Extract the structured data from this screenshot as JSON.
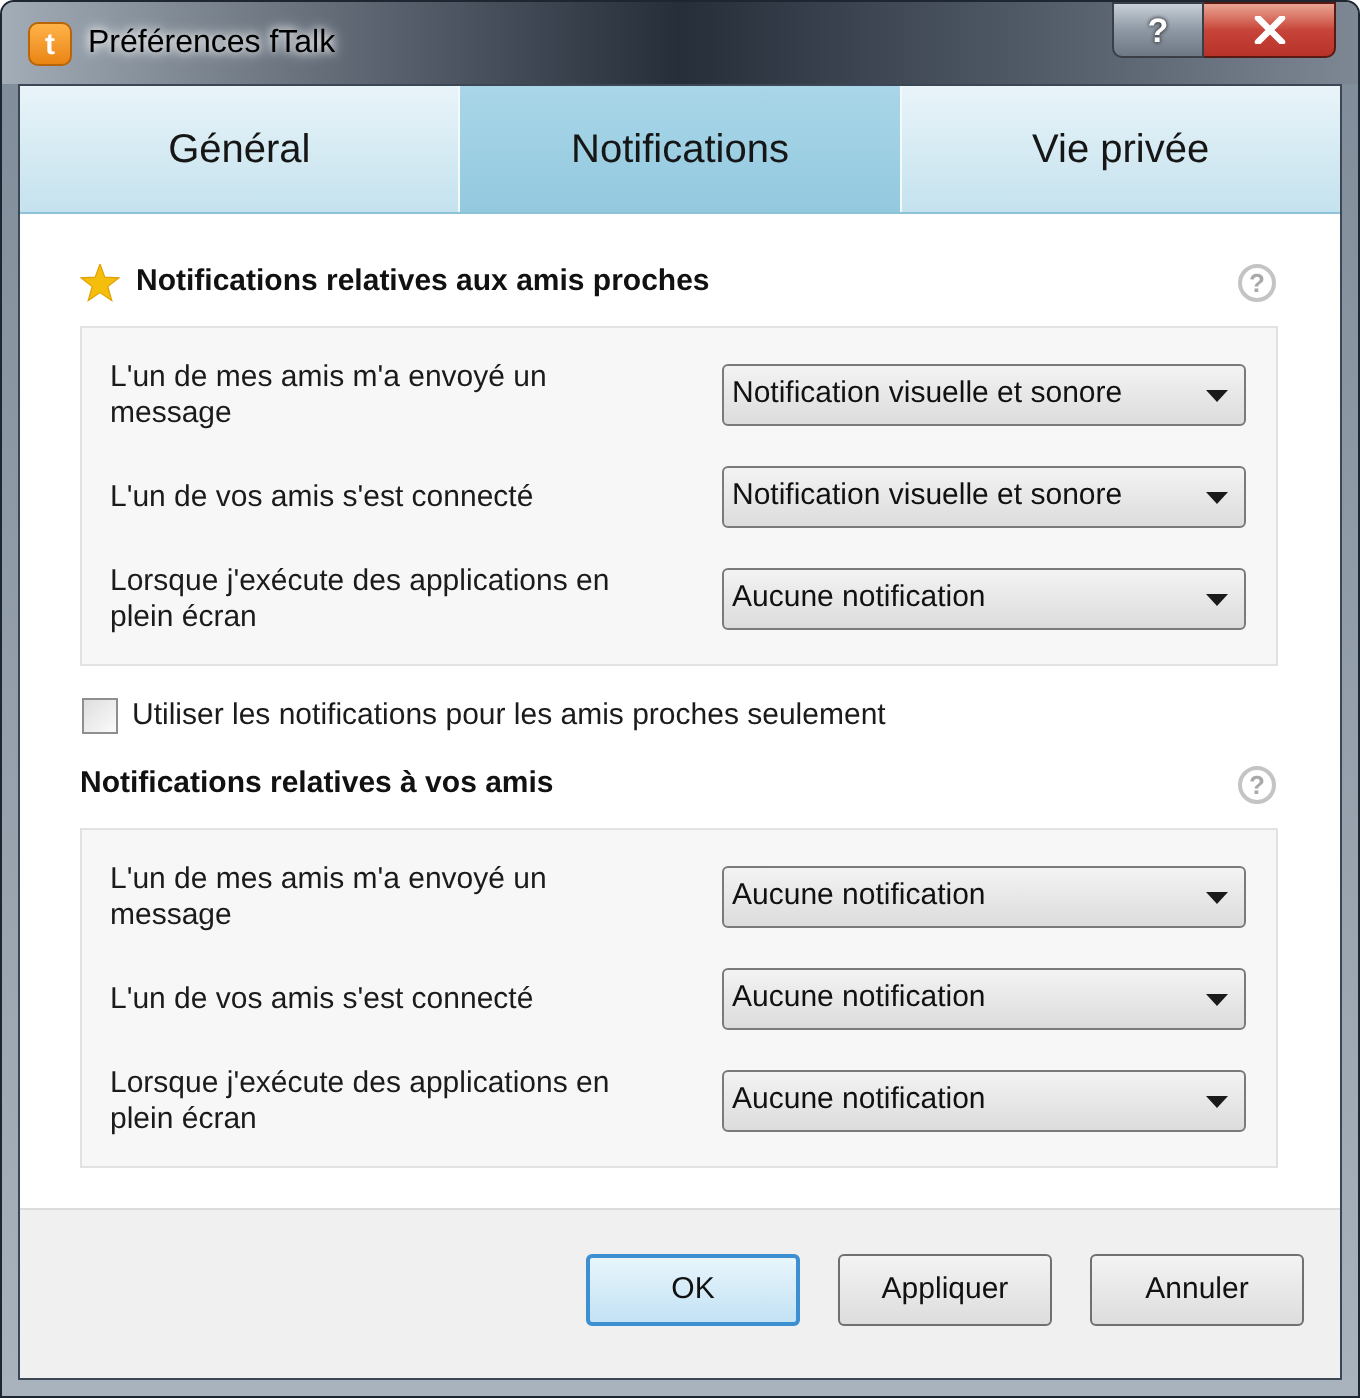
{
  "window": {
    "title": "Préférences fTalk",
    "logo_letter": "t",
    "help_button": "?"
  },
  "tabs": [
    {
      "label": "Général",
      "selected": false
    },
    {
      "label": "Notifications",
      "selected": true
    },
    {
      "label": "Vie privée",
      "selected": false
    }
  ],
  "content": [
    {
      "kind": "section",
      "title": "Notifications relatives aux amis proches",
      "starred": true,
      "help": "?",
      "rows": [
        {
          "label": "L'un de mes amis m'a envoyé un message",
          "value": "Notification visuelle et sonore"
        },
        {
          "label": "L'un de vos amis s'est connecté",
          "value": "Notification visuelle et sonore"
        },
        {
          "label": "Lorsque j'exécute des applications en plein écran",
          "value": "Aucune notification"
        }
      ]
    },
    {
      "kind": "checkbox",
      "label": "Utiliser les notifications pour les amis proches seulement",
      "checked": false
    },
    {
      "kind": "section",
      "title": "Notifications relatives à vos amis",
      "starred": false,
      "help": "?",
      "rows": [
        {
          "label": "L'un de mes amis m'a envoyé un message",
          "value": "Aucune notification"
        },
        {
          "label": "L'un de vos amis s'est connecté",
          "value": "Aucune notification"
        },
        {
          "label": "Lorsque j'exécute des applications en plein écran",
          "value": "Aucune notification"
        }
      ]
    }
  ],
  "buttons": [
    {
      "label": "OK",
      "focused": true
    },
    {
      "label": "Appliquer",
      "focused": false
    },
    {
      "label": "Annuler",
      "focused": false
    }
  ]
}
